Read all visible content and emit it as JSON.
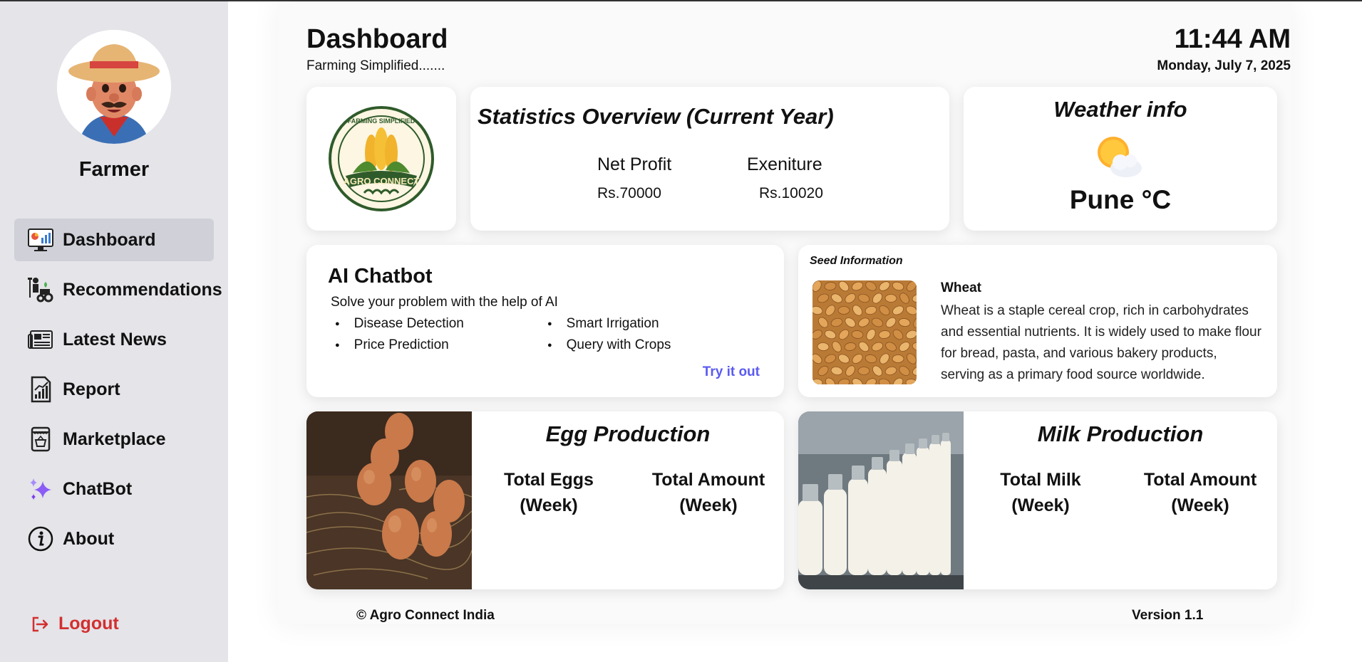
{
  "sidebar": {
    "user_name": "Farmer",
    "items": [
      {
        "label": "Dashboard",
        "icon": "dashboard-monitor-icon",
        "active": true
      },
      {
        "label": "Recommendations",
        "icon": "farmer-tractor-icon"
      },
      {
        "label": "Latest News",
        "icon": "newspaper-icon"
      },
      {
        "label": "Report",
        "icon": "report-chart-icon"
      },
      {
        "label": "Marketplace",
        "icon": "shop-basket-icon"
      },
      {
        "label": "ChatBot",
        "icon": "sparkle-icon"
      },
      {
        "label": "About",
        "icon": "info-icon"
      }
    ],
    "logout_label": "Logout"
  },
  "header": {
    "title": "Dashboard",
    "subtitle": "Farming Simplified.......",
    "time": "11:44 AM",
    "date": "Monday, July 7, 2025"
  },
  "stats": {
    "title": "Statistics Overview (Current Year)",
    "net_profit_label": "Net Profit",
    "net_profit_value": "Rs.70000",
    "expenditure_label": "Exeniture",
    "expenditure_value": "Rs.10020"
  },
  "weather": {
    "title": "Weather info",
    "location": "Pune °C",
    "icon": "partly-cloudy-icon"
  },
  "chatbot": {
    "title": "AI Chatbot",
    "description": "Solve your problem with the help of AI",
    "features": [
      "Disease Detection",
      "Smart Irrigation",
      "Price Prediction",
      "Query with Crops"
    ],
    "cta": "Try it out"
  },
  "seed": {
    "heading": "Seed Information",
    "name": "Wheat",
    "description": "Wheat is a staple cereal crop, rich in carbohydrates and essential nutrients. It is widely used to make flour for bread, pasta, and various bakery products, serving as a primary food source worldwide."
  },
  "egg": {
    "title": "Egg Production",
    "stat1": "Total Eggs (Week)",
    "stat2": "Total Amount (Week)"
  },
  "milk": {
    "title": "Milk Production",
    "stat1": "Total Milk (Week)",
    "stat2": "Total Amount (Week)"
  },
  "logo_text": "AGRO CONNECT",
  "logo_ring_text": "FARMING SIMPLIFIED",
  "footer": {
    "copyright": "© Agro Connect India",
    "version": "Version 1.1"
  },
  "colors": {
    "sidebar_bg": "#e4e4e9",
    "active_item_bg": "#cfd0d8",
    "logout": "#d32f2f",
    "link": "#5b5bf0"
  }
}
